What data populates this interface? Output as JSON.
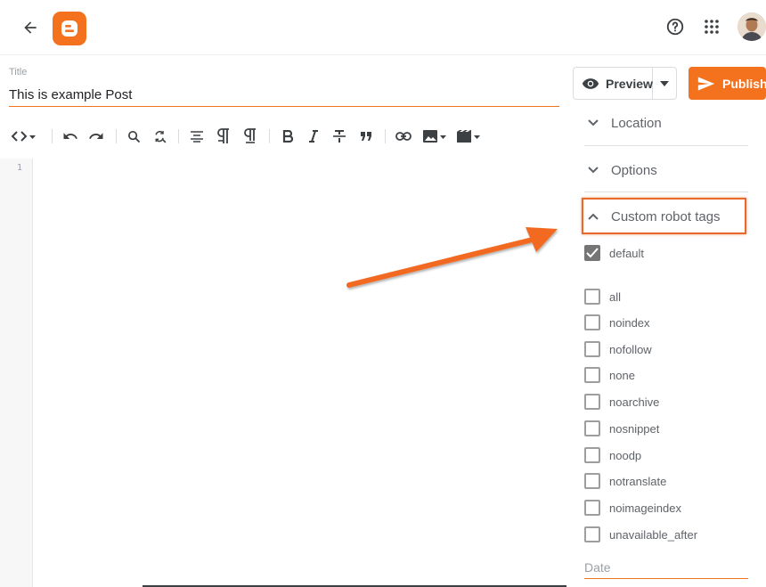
{
  "header": {
    "back_icon": "arrow-back-icon",
    "logo_icon": "blogger-logo",
    "help_icon": "help-circle-icon",
    "apps_icon": "apps-grid-icon",
    "avatar_icon": "user-avatar"
  },
  "post": {
    "title_label": "Title",
    "title_value": "This is example Post"
  },
  "toolbar": {
    "icons": [
      "code-view-icon",
      "undo-icon",
      "redo-icon",
      "search-icon",
      "replace-icon",
      "align-icon",
      "paragraph-icon",
      "paragraph-alt-icon",
      "bold-icon",
      "italic-icon",
      "strikethrough-icon",
      "quote-icon",
      "link-icon",
      "image-icon",
      "video-icon"
    ]
  },
  "editor": {
    "line_numbers": [
      "1"
    ]
  },
  "actions": {
    "preview_label": "Preview",
    "publish_label": "Publish"
  },
  "sidebar": {
    "sections": [
      {
        "label": "Location",
        "expanded": false
      },
      {
        "label": "Options",
        "expanded": false
      },
      {
        "label": "Custom robot tags",
        "expanded": true
      }
    ],
    "robot_tags": [
      {
        "label": "default",
        "checked": true
      },
      {
        "label": "all",
        "checked": false
      },
      {
        "label": "noindex",
        "checked": false
      },
      {
        "label": "nofollow",
        "checked": false
      },
      {
        "label": "none",
        "checked": false
      },
      {
        "label": "noarchive",
        "checked": false
      },
      {
        "label": "nosnippet",
        "checked": false
      },
      {
        "label": "noodp",
        "checked": false
      },
      {
        "label": "notranslate",
        "checked": false
      },
      {
        "label": "noimageindex",
        "checked": false
      },
      {
        "label": "unavailable_after",
        "checked": false
      }
    ],
    "date_placeholder": "Date"
  },
  "colors": {
    "accent": "#f4721e",
    "annotation": "#e8692c"
  }
}
